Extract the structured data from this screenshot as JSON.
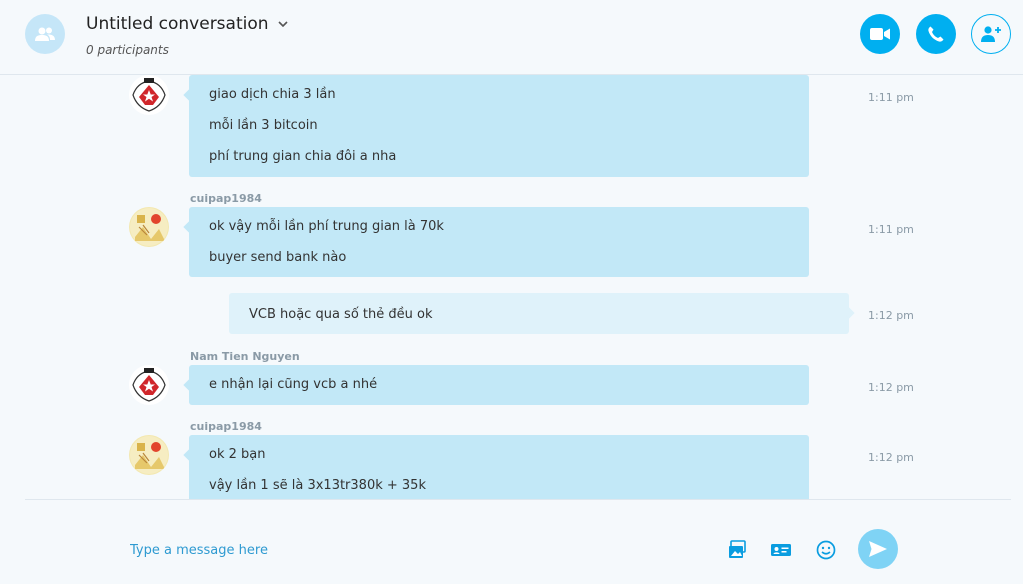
{
  "header": {
    "title": "Untitled conversation",
    "participants": "0 participants",
    "icons": {
      "group": "group-icon",
      "dropdown": "chevron-down-icon",
      "video": "video-call-icon",
      "call": "phone-icon",
      "add_people": "add-person-icon"
    }
  },
  "messages": [
    {
      "sender": "",
      "lines": [
        "giao dịch chia 3 lần",
        "mỗi lần 3 bitcoin",
        "phí trung gian chia đôi a nha"
      ],
      "time": "1:11 pm",
      "direction": "incoming"
    },
    {
      "sender": "cuipap1984",
      "lines": [
        "ok vậy mỗi lần phí trung gian là 70k",
        "buyer send bank nào"
      ],
      "time": "1:11 pm",
      "direction": "incoming"
    },
    {
      "sender": "",
      "lines": [
        "VCB hoặc qua số thẻ đều ok"
      ],
      "time": "1:12 pm",
      "direction": "outgoing"
    },
    {
      "sender": "Nam Tien Nguyen",
      "lines": [
        "e nhận lại cũng vcb a nhé"
      ],
      "time": "1:12 pm",
      "direction": "incoming"
    },
    {
      "sender": "cuipap1984",
      "lines": [
        "ok 2 bạn",
        "vậy lần 1 sẽ là 3x13tr380k + 35k"
      ],
      "time": "1:12 pm",
      "direction": "incoming"
    }
  ],
  "composer": {
    "placeholder": "Type a message here",
    "icons": [
      "image-icon",
      "contact-card-icon",
      "emoji-icon",
      "send-icon"
    ]
  },
  "colors": {
    "accent": "#00aff0",
    "incoming_bubble": "#c2e8f7",
    "outgoing_bubble": "#dff2fa",
    "send_button": "#7fd3f5"
  }
}
